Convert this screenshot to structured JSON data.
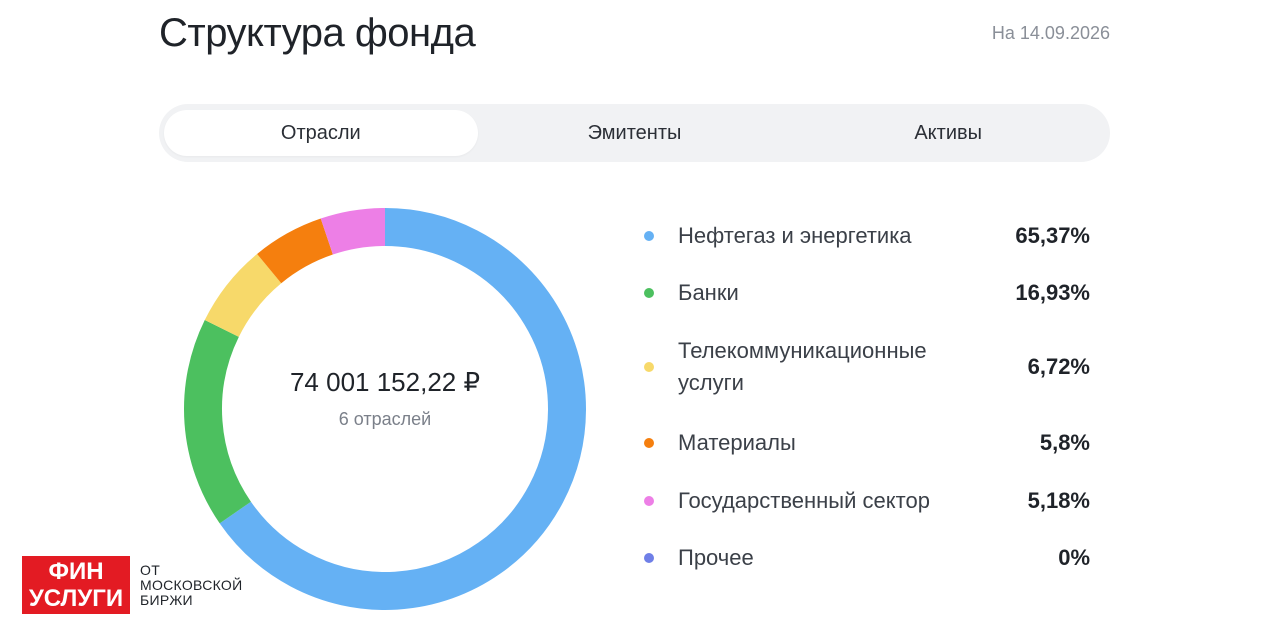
{
  "header": {
    "title": "Структура фонда",
    "date": "На 14.09.2026"
  },
  "tabs": [
    {
      "label": "Отрасли",
      "active": true
    },
    {
      "label": "Эмитенты",
      "active": false
    },
    {
      "label": "Активы",
      "active": false
    }
  ],
  "donut": {
    "total": "74 001 152,22 ₽",
    "count_label": "6 отраслей"
  },
  "chart_data": {
    "type": "pie",
    "categories": [
      "Нефтегаз и энергетика",
      "Банки",
      "Телекоммуникационные услуги",
      "Материалы",
      "Государственный сектор",
      "Прочее"
    ],
    "values": [
      65.37,
      16.93,
      6.72,
      5.8,
      5.18,
      0
    ],
    "colors": [
      "#65b1f4",
      "#4cc05f",
      "#f7d96a",
      "#f57f0e",
      "#ed7fe6",
      "#6f7fe7"
    ]
  },
  "legend": [
    {
      "label": "Нефтегаз и энергетика",
      "value": "65,37%",
      "color": "#65b1f4"
    },
    {
      "label": "Банки",
      "value": "16,93%",
      "color": "#4cc05f"
    },
    {
      "label": "Телекоммуникационные услуги",
      "value": "6,72%",
      "color": "#f7d96a"
    },
    {
      "label": "Материалы",
      "value": "5,8%",
      "color": "#f57f0e"
    },
    {
      "label": "Государственный сектор",
      "value": "5,18%",
      "color": "#ed7fe6"
    },
    {
      "label": "Прочее",
      "value": "0%",
      "color": "#6f7fe7"
    }
  ],
  "brand": {
    "logo_line1": "ФИН",
    "logo_line2": "УСЛУГИ",
    "text_line1": "ОТ",
    "text_line2": "МОСКОВСКОЙ",
    "text_line3": "БИРЖИ"
  }
}
